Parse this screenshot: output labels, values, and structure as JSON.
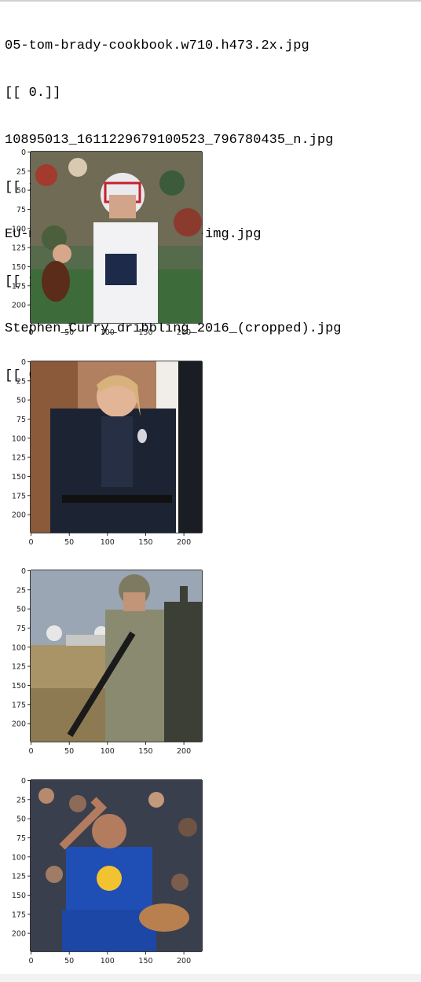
{
  "output_lines": [
    "05-tom-brady-cookbook.w710.h473.2x.jpg",
    "[[ 0.]]",
    "10895013_1611229679100523_796780435_n.jpg",
    "[[ 1.]]",
    "EU-military-exercise-rtr-img.jpg",
    "[[ 1.]]",
    "Stephen_Curry_dribbling_2016_(cropped).jpg",
    "[[ 0.]]"
  ],
  "x_ticks": [
    "0",
    "50",
    "100",
    "150",
    "200"
  ],
  "y_ticks": [
    "0",
    "25",
    "50",
    "75",
    "100",
    "125",
    "150",
    "175",
    "200"
  ],
  "chart_data": [
    {
      "type": "image",
      "subject": "football-quarterback",
      "xlim": [
        0,
        224
      ],
      "ylim": [
        224,
        0
      ],
      "x_ticks": [
        0,
        50,
        100,
        150,
        200
      ],
      "y_ticks": [
        0,
        25,
        50,
        75,
        100,
        125,
        150,
        175,
        200
      ]
    },
    {
      "type": "image",
      "subject": "police-officer",
      "xlim": [
        0,
        224
      ],
      "ylim": [
        224,
        0
      ],
      "x_ticks": [
        0,
        50,
        100,
        150,
        200
      ],
      "y_ticks": [
        0,
        25,
        50,
        75,
        100,
        125,
        150,
        175,
        200
      ]
    },
    {
      "type": "image",
      "subject": "soldier-with-rifle",
      "xlim": [
        0,
        224
      ],
      "ylim": [
        224,
        0
      ],
      "x_ticks": [
        0,
        50,
        100,
        150,
        200
      ],
      "y_ticks": [
        0,
        25,
        50,
        75,
        100,
        125,
        150,
        175,
        200
      ]
    },
    {
      "type": "image",
      "subject": "basketball-player",
      "xlim": [
        0,
        224
      ],
      "ylim": [
        224,
        0
      ],
      "x_ticks": [
        0,
        50,
        100,
        150,
        200
      ],
      "y_ticks": [
        0,
        25,
        50,
        75,
        100,
        125,
        150,
        175,
        200
      ]
    }
  ]
}
